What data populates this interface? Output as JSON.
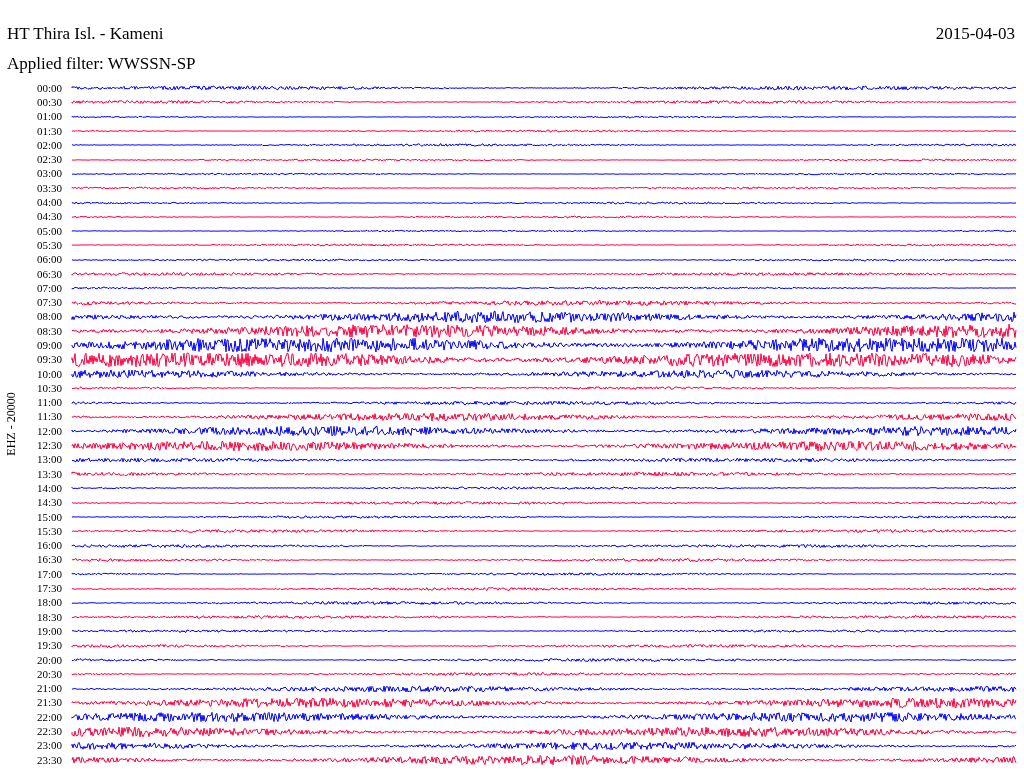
{
  "title": "HT Thira Isl. - Kameni",
  "date": "2015-04-03",
  "filter": "Applied filter: WWSSN-SP",
  "axis_label": "EHZ - 20000",
  "traces": [
    {
      "time": "00:00",
      "color": "#0000ff"
    },
    {
      "time": "00:30",
      "color": "#ff0040"
    },
    {
      "time": "01:00",
      "color": "#0000ff"
    },
    {
      "time": "01:30",
      "color": "#ff0040"
    },
    {
      "time": "02:00",
      "color": "#0000ff"
    },
    {
      "time": "02:30",
      "color": "#ff0040"
    },
    {
      "time": "03:00",
      "color": "#0000ff"
    },
    {
      "time": "03:30",
      "color": "#ff0040"
    },
    {
      "time": "04:00",
      "color": "#0000ff"
    },
    {
      "time": "04:30",
      "color": "#ff0040"
    },
    {
      "time": "05:00",
      "color": "#0000ff"
    },
    {
      "time": "05:30",
      "color": "#ff0040"
    },
    {
      "time": "06:00",
      "color": "#0000ff"
    },
    {
      "time": "06:30",
      "color": "#ff0040"
    },
    {
      "time": "07:00",
      "color": "#0000ff"
    },
    {
      "time": "07:30",
      "color": "#ff0040"
    },
    {
      "time": "08:00",
      "color": "#0000ff"
    },
    {
      "time": "08:30",
      "color": "#ff0040"
    },
    {
      "time": "09:00",
      "color": "#0000ff"
    },
    {
      "time": "09:30",
      "color": "#ff0040"
    },
    {
      "time": "10:00",
      "color": "#0000ff"
    },
    {
      "time": "10:30",
      "color": "#ff0040"
    },
    {
      "time": "11:00",
      "color": "#0000ff"
    },
    {
      "time": "11:30",
      "color": "#ff0040"
    },
    {
      "time": "12:00",
      "color": "#0000ff"
    },
    {
      "time": "12:30",
      "color": "#ff0040"
    },
    {
      "time": "13:00",
      "color": "#0000ff"
    },
    {
      "time": "13:30",
      "color": "#ff0040"
    },
    {
      "time": "14:00",
      "color": "#0000ff"
    },
    {
      "time": "14:30",
      "color": "#ff0040"
    },
    {
      "time": "15:00",
      "color": "#0000ff"
    },
    {
      "time": "15:30",
      "color": "#ff0040"
    },
    {
      "time": "16:00",
      "color": "#0000ff"
    },
    {
      "time": "16:30",
      "color": "#ff0040"
    },
    {
      "time": "17:00",
      "color": "#0000ff"
    },
    {
      "time": "17:30",
      "color": "#ff0040"
    },
    {
      "time": "18:00",
      "color": "#0000ff"
    },
    {
      "time": "18:30",
      "color": "#ff0040"
    },
    {
      "time": "19:00",
      "color": "#0000ff"
    },
    {
      "time": "19:30",
      "color": "#ff0040"
    },
    {
      "time": "20:00",
      "color": "#0000ff"
    },
    {
      "time": "20:30",
      "color": "#ff0040"
    },
    {
      "time": "21:00",
      "color": "#0000ff"
    },
    {
      "time": "21:30",
      "color": "#ff0040"
    },
    {
      "time": "22:00",
      "color": "#0000ff"
    },
    {
      "time": "22:30",
      "color": "#ff0040"
    },
    {
      "time": "23:00",
      "color": "#0000ff"
    },
    {
      "time": "23:30",
      "color": "#ff0040"
    }
  ]
}
